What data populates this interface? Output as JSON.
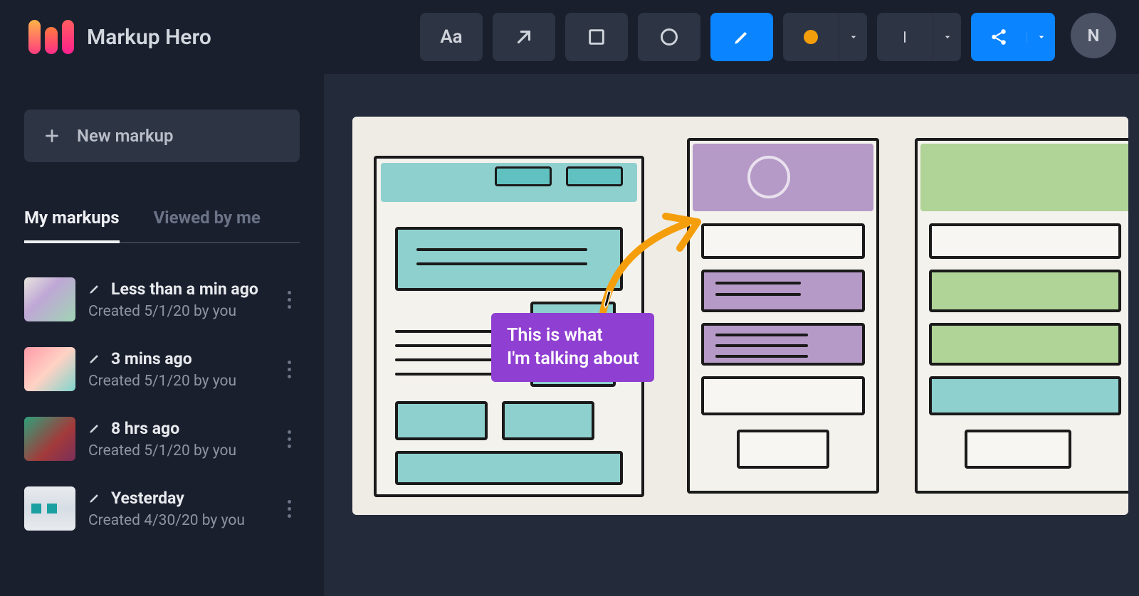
{
  "app": {
    "title": "Markup Hero"
  },
  "toolbar": {
    "text_tool": "Aa",
    "color_swatch": "#f59e0b"
  },
  "avatar": {
    "initial": "N"
  },
  "sidebar": {
    "new_markup_label": "New markup",
    "tabs": {
      "my_markups": "My markups",
      "viewed_by_me": "Viewed by me"
    },
    "items": [
      {
        "title": "Less than a min ago",
        "subtitle": "Created 5/1/20 by you"
      },
      {
        "title": "3 mins ago",
        "subtitle": "Created 5/1/20 by you"
      },
      {
        "title": "8 hrs ago",
        "subtitle": "Created 5/1/20 by you"
      },
      {
        "title": "Yesterday",
        "subtitle": "Created 4/30/20 by you"
      }
    ]
  },
  "canvas": {
    "annotation_text": "This is what\nI'm talking about"
  }
}
